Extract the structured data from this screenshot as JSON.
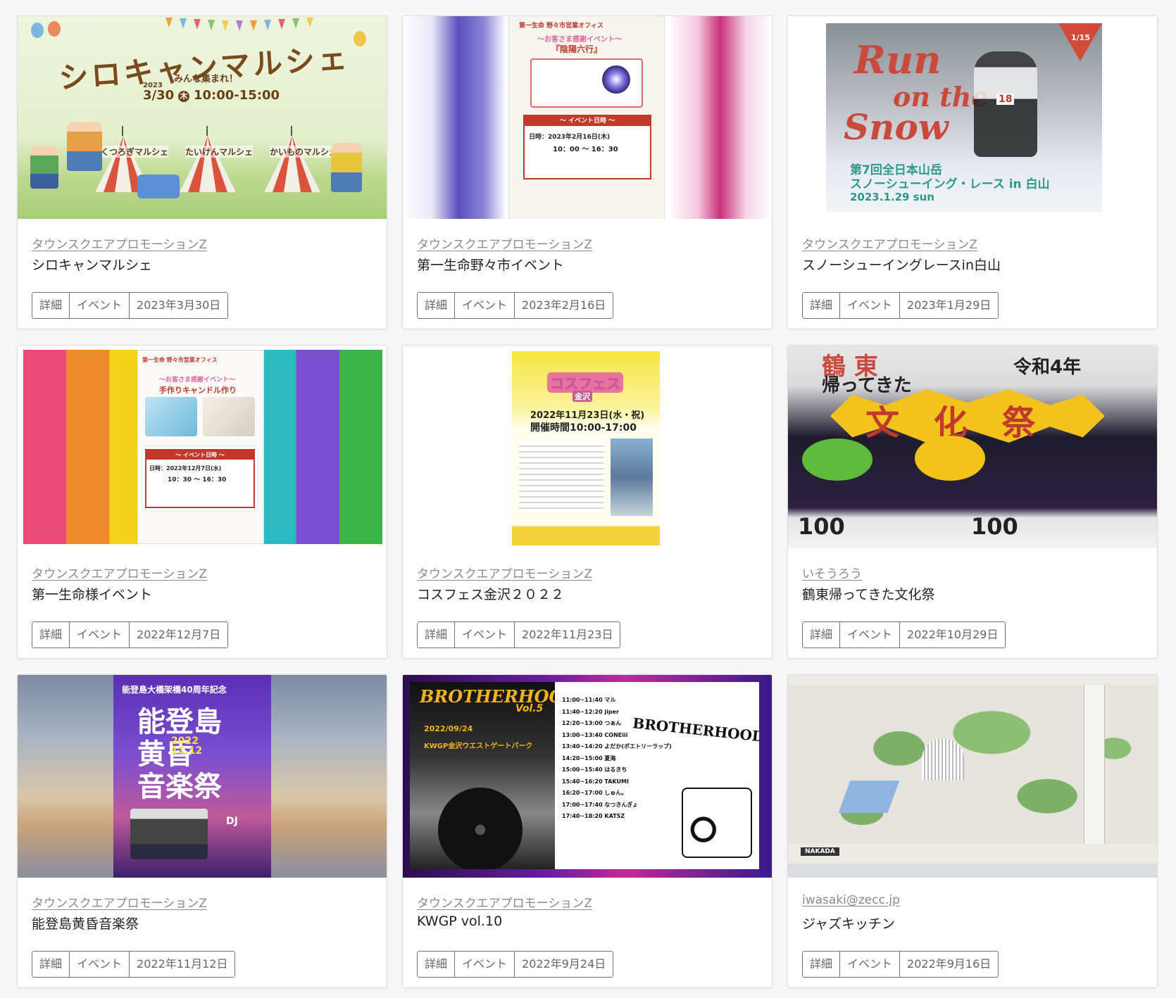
{
  "cards": [
    {
      "author": "タウンスクエアプロモーションZ",
      "title": "シロキャンマルシェ",
      "tags": [
        "詳細",
        "イベント",
        "2023年3月30日"
      ],
      "poster": {
        "main": "シロキャンマルシェ",
        "sub": "みんな集まれ！",
        "year": "2023",
        "date": "3/30",
        "day": "木",
        "time": "10:00-15:00",
        "tents": [
          "くつろぎマルシェ",
          "たいけんマルシェ",
          "かいものマルシェ"
        ]
      }
    },
    {
      "author": "タウンスクエアプロモーションZ",
      "title": "第一生命野々市イベント",
      "tags": [
        "詳細",
        "イベント",
        "2023年2月16日"
      ],
      "poster": {
        "header": "第一生命 野々市営業オフィス",
        "sub": "～お客さま感謝イベント～",
        "name": "『陰陽六行』",
        "info": "～ イベント日時 ～",
        "date": "日時：2023年2月16日(木)",
        "time": "10：00 ～ 16：30"
      }
    },
    {
      "author": "タウンスクエアプロモーションZ",
      "title": "スノーシューイングレースin白山",
      "tags": [
        "詳細",
        "イベント",
        "2023年1月29日"
      ],
      "poster": {
        "line1": "Run",
        "line2": "on the",
        "line3": "Snow",
        "jp1": "第7回全日本山岳",
        "jp2": "スノーシューイング・レース in 白山",
        "date": "2023.1.29 sun",
        "bib": "18",
        "badge": "1/15"
      }
    },
    {
      "author": "タウンスクエアプロモーションZ",
      "title": "第一生命様イベント",
      "tags": [
        "詳細",
        "イベント",
        "2022年12月7日"
      ],
      "poster": {
        "header": "第一生命 野々市営業オフィス",
        "sub": "～お客さま感謝イベント～",
        "name": "手作りキャンドル作り",
        "info": "～ イベント日時 ～",
        "date": "日時：2022年12月7日(水)",
        "time": "10：30 ～ 16：30"
      }
    },
    {
      "author": "タウンスクエアプロモーションZ",
      "title": "コスフェス金沢２０２２",
      "tags": [
        "詳細",
        "イベント",
        "2022年11月23日"
      ],
      "poster": {
        "logo": "コスフェス",
        "logo2": "金沢",
        "date": "2022年11月23日(水・祝)",
        "time": "開催時間10:00-17:00"
      }
    },
    {
      "author": "いそうろう",
      "title": "鶴東帰ってきた文化祭",
      "tags": [
        "詳細",
        "イベント",
        "2022年10月29日"
      ],
      "poster": {
        "line1": "鶴 東",
        "line2": "帰ってきた",
        "reiwa": "令和4年",
        "main": "文 化 祭",
        "coupon": "100"
      }
    },
    {
      "author": "タウンスクエアプロモーションZ",
      "title": "能登島黄昏音楽祭",
      "tags": [
        "詳細",
        "イベント",
        "2022年11月12日"
      ],
      "poster": {
        "header": "能登島大橋架橋40周年記念",
        "main1": "能登島",
        "main2": "黄昏",
        "main3": "音楽祭",
        "date": "2022",
        "date2": "11.12",
        "dj": "DJ"
      }
    },
    {
      "author": "タウンスクエアプロモーションZ",
      "title": "KWGP vol.10",
      "tags": [
        "詳細",
        "イベント",
        "2022年9月24日"
      ],
      "poster": {
        "logo": "BROTHERHOOD",
        "vol": "Vol.5",
        "date": "2022/09/24",
        "place": "KWGP金沢ウエストゲートパーク",
        "brand": "BROTHERHOOD",
        "lineup": [
          "11:00~11:40 マル",
          "11:40~12:20 jiper",
          "12:20~13:00 つぁん",
          "13:00~13:40 CONEiii",
          "13:40~14:20 よだか(ポエトリーラップ)",
          "14:20~15:00 夏海",
          "15:00~15:40 はるきち",
          "15:40~16:20 TAKUMI",
          "16:20~17:00 しゅん。",
          "17:00~17:40 なつきんぎょ",
          "17:40~18:20 KATSZ"
        ]
      }
    },
    {
      "author": "iwasaki@zecc.jp",
      "title": "ジャズキッチン",
      "tags": [
        "詳細",
        "イベント",
        "2022年9月16日"
      ],
      "poster": {
        "footer": "NAKADA"
      }
    }
  ]
}
